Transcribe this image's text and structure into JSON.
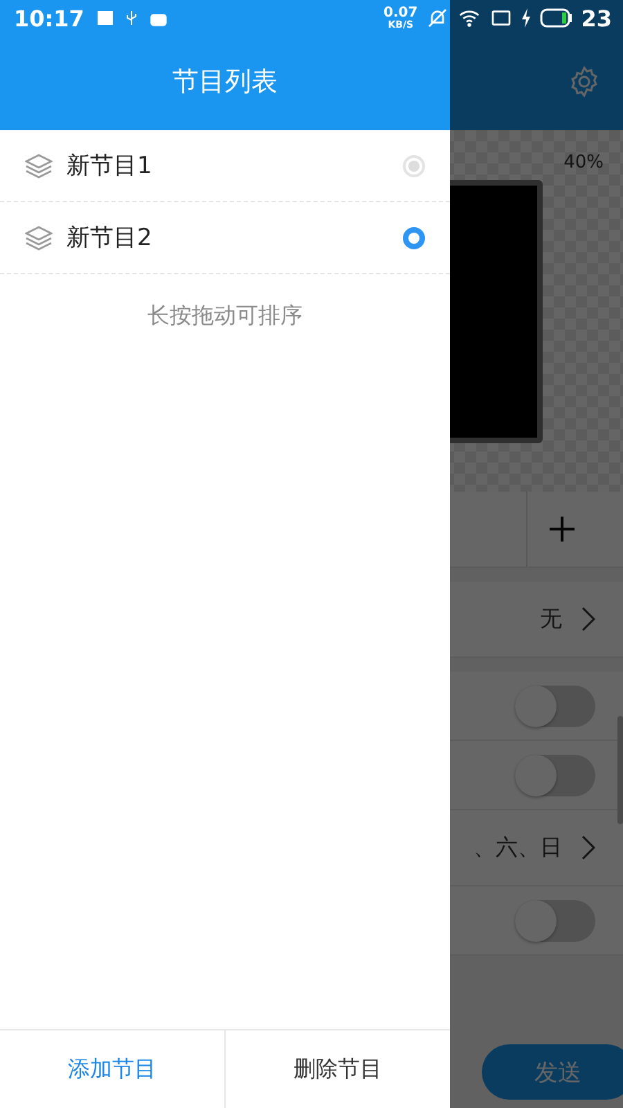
{
  "status_bar": {
    "time": "10:17",
    "net_speed": "0.07",
    "net_unit": "KB/S",
    "battery": "23"
  },
  "drawer": {
    "title": "节目列表",
    "programs": [
      {
        "name": "新节目1",
        "selected": false
      },
      {
        "name": "新节目2",
        "selected": true
      }
    ],
    "hint": "长按拖动可排序",
    "buttons": [
      {
        "label": "添加节目",
        "kind": "primary"
      },
      {
        "label": "删除节目",
        "kind": "plain"
      }
    ]
  },
  "background": {
    "zoom": "40%",
    "rows": [
      {
        "kind": "add"
      },
      {
        "kind": "value",
        "value": "无"
      },
      {
        "kind": "toggle",
        "on": false
      },
      {
        "kind": "toggle",
        "on": false
      },
      {
        "kind": "value",
        "value": "、六、日"
      },
      {
        "kind": "toggle",
        "on": false
      }
    ],
    "send_button": "发送"
  }
}
